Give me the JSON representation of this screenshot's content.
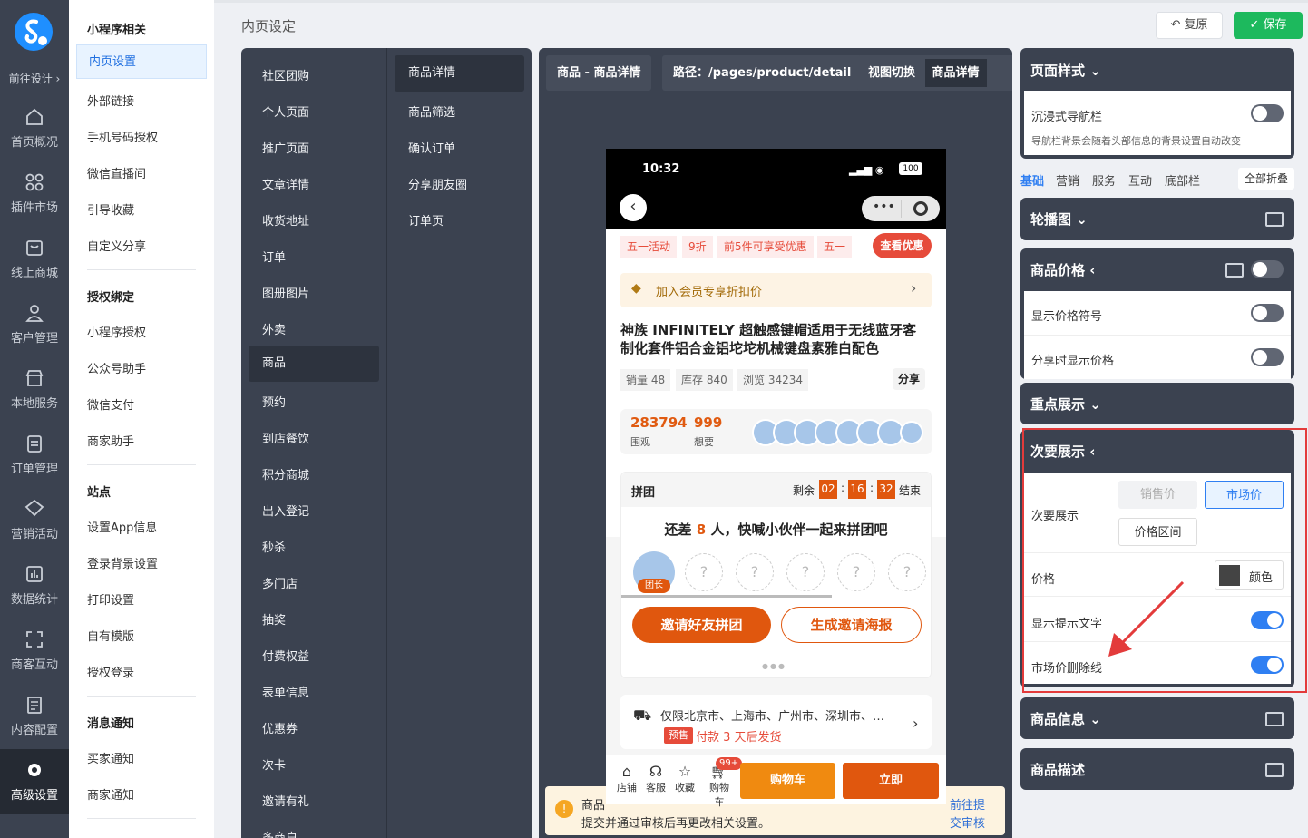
{
  "left_nav": {
    "front_design": "前往设计 ›",
    "items": [
      "首页概况",
      "插件市场",
      "线上商城",
      "客户管理",
      "本地服务",
      "订单管理",
      "营销活动",
      "数据统计",
      "商客互动",
      "内容配置",
      "高级设置"
    ]
  },
  "sub_nav": {
    "group1": "小程序相关",
    "g1": [
      "内页设置",
      "外部链接",
      "手机号码授权",
      "微信直播间",
      "引导收藏",
      "自定义分享"
    ],
    "group2": "授权绑定",
    "g2": [
      "小程序授权",
      "公众号助手",
      "微信支付",
      "商家助手"
    ],
    "group3": "站点",
    "g3": [
      "设置App信息",
      "登录背景设置",
      "打印设置",
      "自有模版",
      "授权登录"
    ],
    "group4": "消息通知",
    "g4": [
      "买家通知",
      "商家通知"
    ]
  },
  "page_title": "内页设定",
  "buttons": {
    "restore": "复原",
    "save": "保存"
  },
  "page_list": [
    "社区团购",
    "个人页面",
    "推广页面",
    "文章详情",
    "收货地址",
    "订单",
    "图册图片",
    "外卖",
    "商品",
    "预约",
    "到店餐饮",
    "积分商城",
    "出入登记",
    "秒杀",
    "多门店",
    "抽奖",
    "付费权益",
    "表单信息",
    "优惠券",
    "次卡",
    "邀请有礼",
    "多商户"
  ],
  "sub_page_list": [
    "商品详情",
    "商品筛选",
    "确认订单",
    "分享朋友圈",
    "订单页"
  ],
  "preview": {
    "tag1": "商品 - 商品详情",
    "tag2": "路径：/pages/product/detail",
    "tag3": "视图切换",
    "tag3_value": "商品详情"
  },
  "phone": {
    "time": "10:32",
    "battery": "100",
    "coupons": [
      "五一活动",
      "9折",
      "前5件可享受优惠",
      "五一"
    ],
    "coupon_btn": "查看优惠",
    "member": "加入会员专享折扣价",
    "product_name": "神族 INFINITELY 超触感键帽适用于无线蓝牙客制化套件铝合金铝坨坨机械键盘素雅白配色",
    "stats": [
      "销量 48",
      "库存 840",
      "浏览 34234"
    ],
    "share": "分享",
    "watch_num": "283794",
    "watch_lbl": "围观",
    "want_num": "999",
    "want_lbl": "想要",
    "group_title": "拼团",
    "remain": "剩余",
    "t1": "02",
    "t2": "16",
    "t3": "32",
    "end": "结束",
    "invite_pre": "还差",
    "invite_num": "8",
    "invite_post": "人，快喊小伙伴一起来拼团吧",
    "leader": "团长",
    "q": "?",
    "btn_invite": "邀请好友拼团",
    "btn_poster": "生成邀请海报",
    "delivery": "仅限北京市、上海市、广州市、深圳市、…",
    "presale": "预售",
    "presale_text": "付款 3 天后发货",
    "bottom": [
      "店铺",
      "客服",
      "收藏",
      "购物车"
    ],
    "badge": "99+",
    "cart": "购物车",
    "buy": "立即"
  },
  "notice": {
    "line1": "商品",
    "line2": "提交并通过审核后再更改相关设置。",
    "link1": "前往提",
    "link2": "交审核"
  },
  "right": {
    "page_style": "页面样式",
    "immersive": "沉浸式导航栏",
    "immersive_tip": "导航栏背景会随着头部信息的背景设置自动改变",
    "tabs": [
      "基础",
      "营销",
      "服务",
      "互动",
      "底部栏"
    ],
    "collapse_all": "全部折叠",
    "carousel": "轮播图",
    "price": "商品价格",
    "show_symbol": "显示价格符号",
    "share_price": "分享时显示价格",
    "key_display": "重点展示",
    "secondary": "次要展示",
    "secondary_lbl": "次要展示",
    "opt_sale": "销售价",
    "opt_market": "市场价",
    "opt_range": "价格区间",
    "price_lbl": "价格",
    "color_btn": "颜色",
    "show_tip": "显示提示文字",
    "strike": "市场价删除线",
    "product_info": "商品信息",
    "product_desc": "商品描述"
  }
}
